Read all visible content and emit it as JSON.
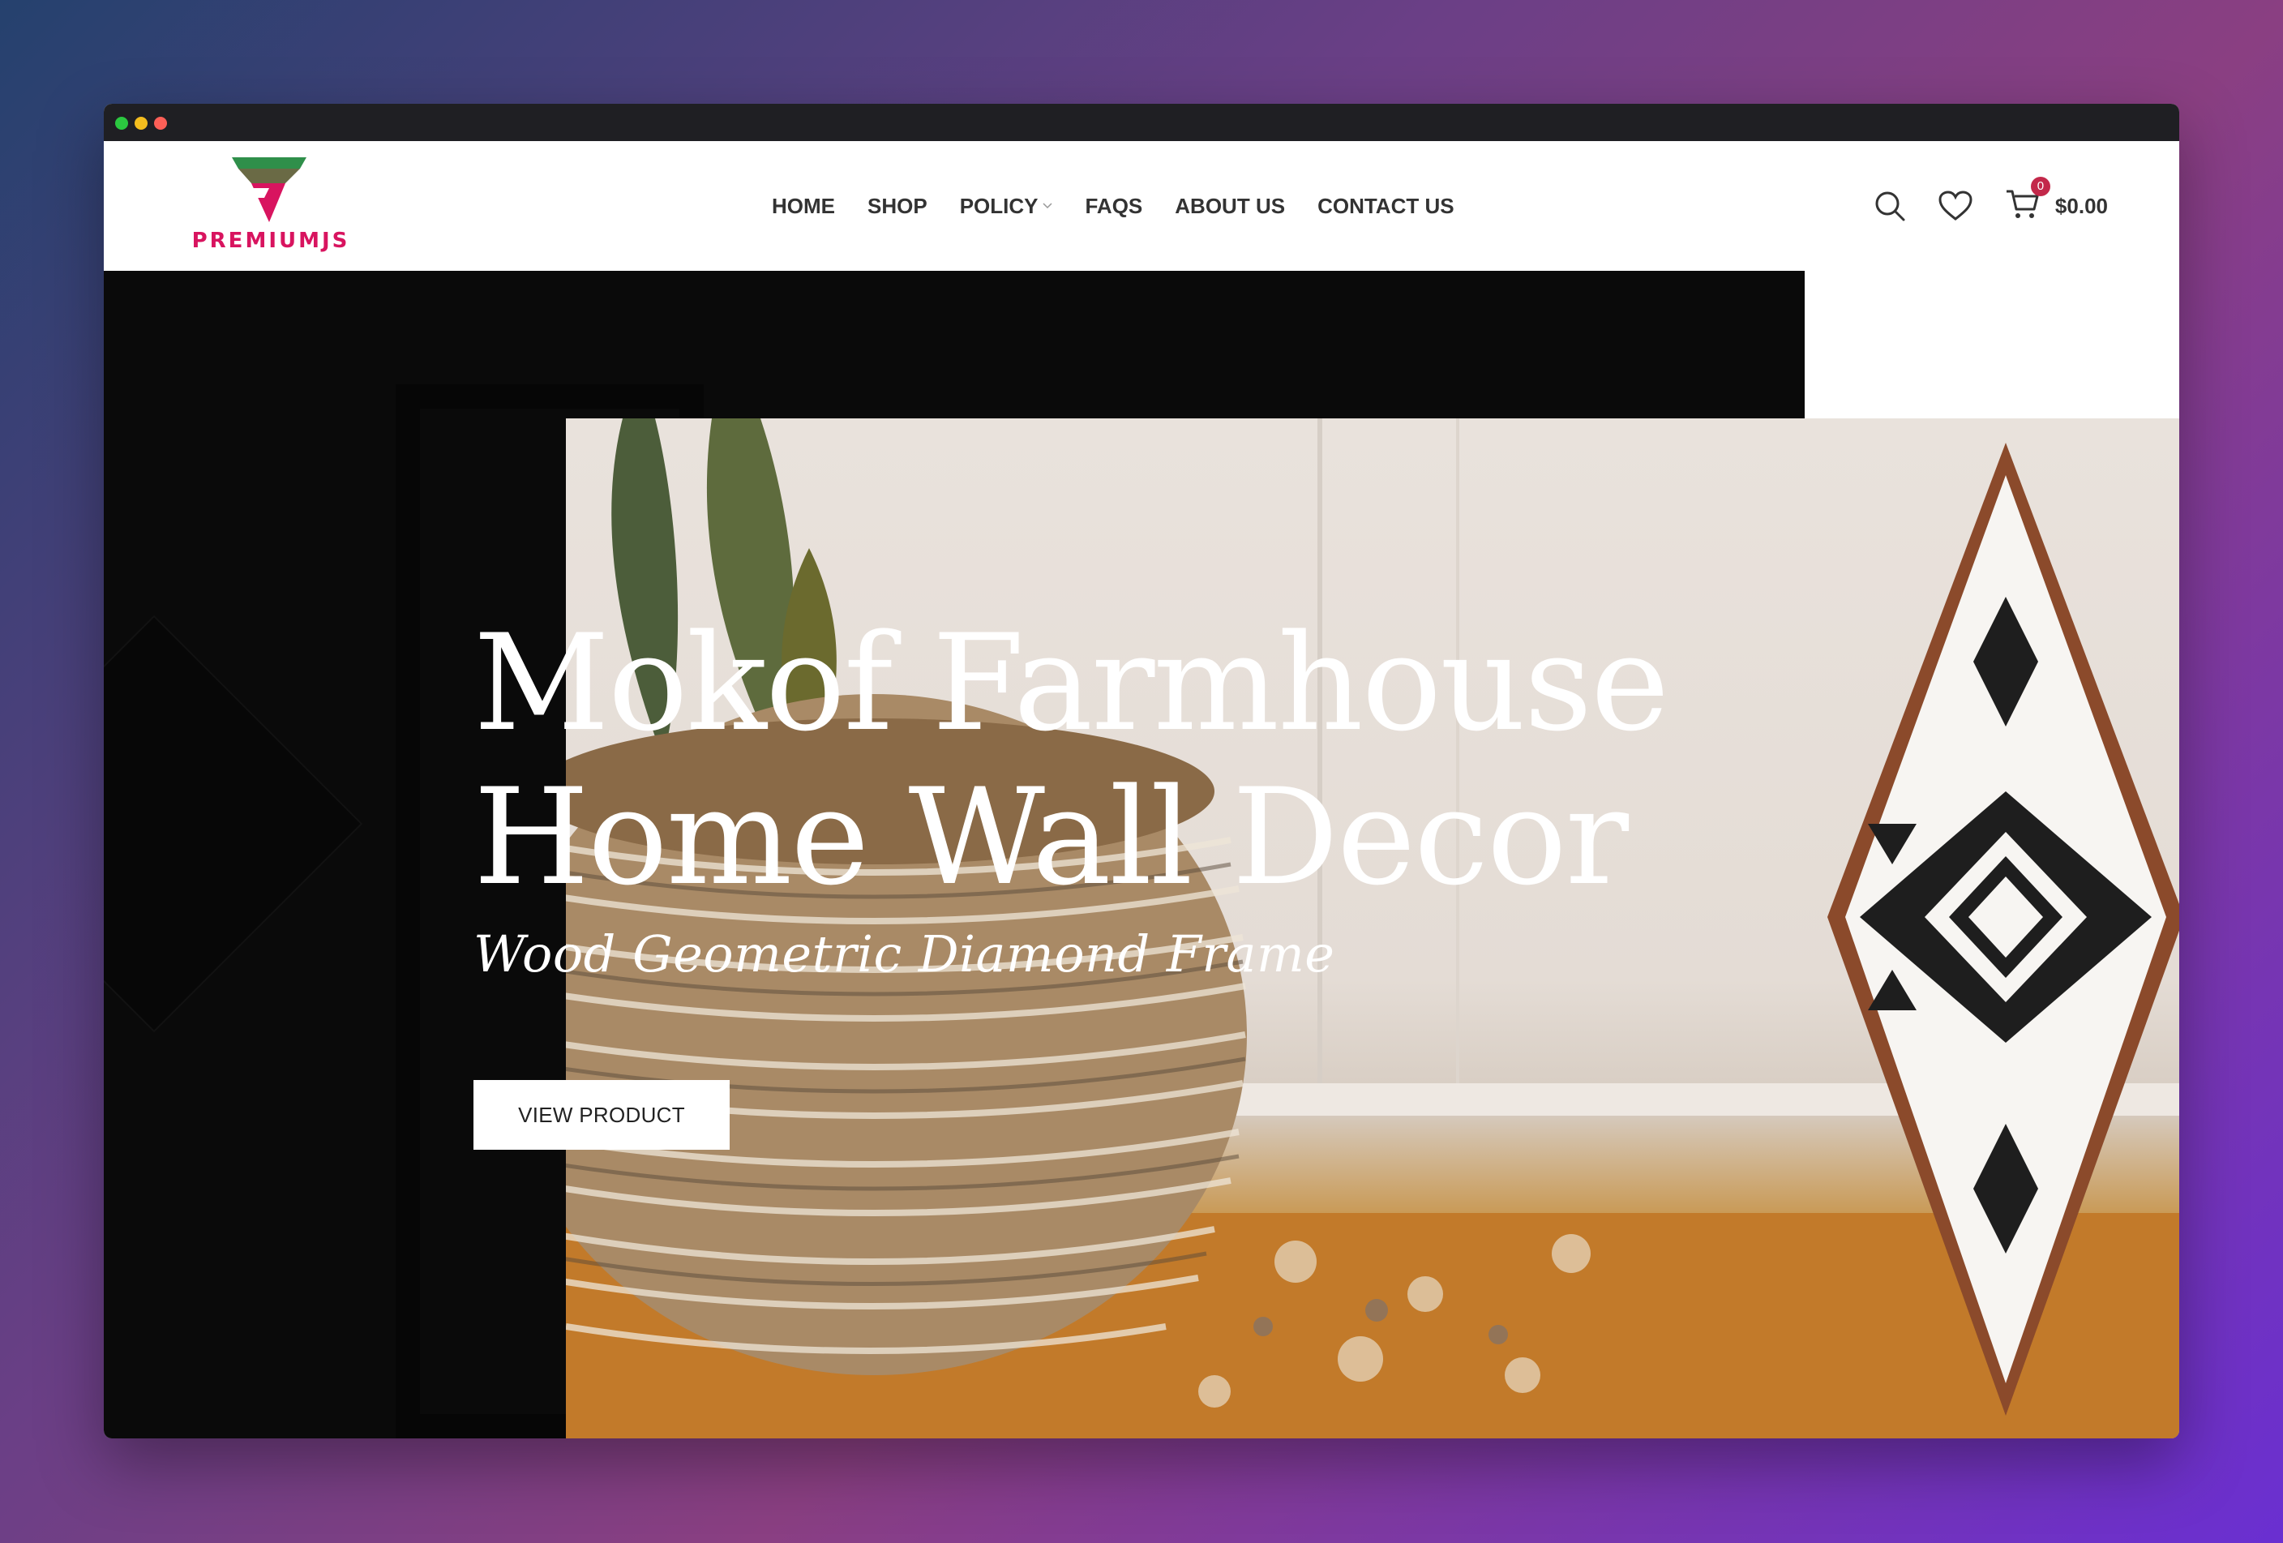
{
  "window": {
    "traffic_lights": [
      "green",
      "yellow",
      "red"
    ]
  },
  "header": {
    "logo_text": "PREMIUMJS",
    "nav": [
      {
        "label": "HOME"
      },
      {
        "label": "SHOP"
      },
      {
        "label": "POLICY",
        "has_dropdown": true
      },
      {
        "label": "FAQS"
      },
      {
        "label": "ABOUT US"
      },
      {
        "label": "CONTACT US"
      }
    ],
    "icons": [
      "search-icon",
      "heart-icon",
      "cart-icon"
    ],
    "cart_count": "0",
    "cart_total": "$0.00"
  },
  "hero": {
    "title_line1": "Mokof Farmhouse",
    "title_line2": "Home Wall Decor",
    "subtitle": "Wood Geometric Diamond Frame",
    "cta_label": "VIEW PRODUCT"
  },
  "colors": {
    "brand_pink": "#d8145f",
    "brand_green": "#2f8f4a",
    "badge": "#c3284a"
  }
}
